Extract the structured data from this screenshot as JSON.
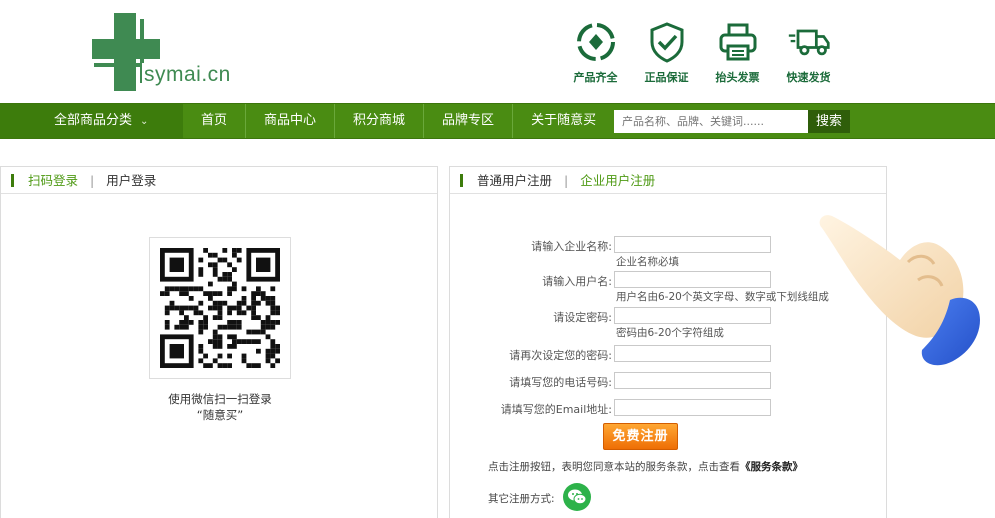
{
  "header": {
    "logo_text": "symai.cn",
    "features": [
      {
        "label": "产品齐全",
        "icon": "recycle-icon"
      },
      {
        "label": "正品保证",
        "icon": "shield-check-icon"
      },
      {
        "label": "抬头发票",
        "icon": "printer-icon"
      },
      {
        "label": "快速发货",
        "icon": "delivery-truck-icon"
      }
    ]
  },
  "nav": {
    "all_categories": "全部商品分类",
    "items": [
      "首页",
      "商品中心",
      "积分商城",
      "品牌专区",
      "关于随意买"
    ],
    "search_placeholder": "产品名称、品牌、关键词......",
    "search_button": "搜索"
  },
  "login_panel": {
    "tab_qr": "扫码登录",
    "tab_user": "用户登录",
    "qr_caption_line1": "使用微信扫一扫登录",
    "qr_caption_line2": "“随意买”"
  },
  "register_panel": {
    "tab_normal": "普通用户注册",
    "tab_enterprise": "企业用户注册",
    "fields": [
      {
        "label": "请输入企业名称:",
        "hint": "企业名称必填"
      },
      {
        "label": "请输入用户名:",
        "hint": "用户名由6-20个英文字母、数字或下划线组成"
      },
      {
        "label": "请设定密码:",
        "hint": "密码由6-20个字符组成"
      },
      {
        "label": "请再次设定您的密码:",
        "hint": ""
      },
      {
        "label": "请填写您的电话号码:",
        "hint": ""
      },
      {
        "label": "请填写您的Email地址:",
        "hint": ""
      }
    ],
    "submit_label": "免费注册",
    "terms_text": "点击注册按钮，表明您同意本站的服务条款，点击查看",
    "terms_link": "《服务条款》",
    "other_methods": "其它注册方式:"
  },
  "colors": {
    "nav_green": "#4a8c12",
    "logo_green": "#3f8a52",
    "button_orange": "#f08a1c"
  }
}
